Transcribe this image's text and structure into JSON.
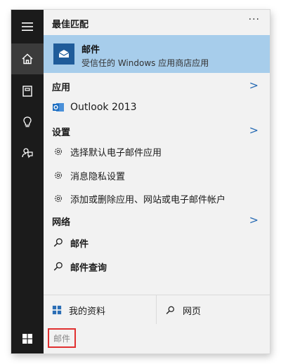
{
  "rail": {
    "items": [
      {
        "icon": "hamburger-menu-icon"
      },
      {
        "icon": "home-icon"
      },
      {
        "icon": "notebook-icon"
      },
      {
        "icon": "lightbulb-icon"
      },
      {
        "icon": "feedback-icon"
      }
    ]
  },
  "header": {
    "best_match_title": "最佳匹配",
    "more": "···"
  },
  "best_match": {
    "title": "邮件",
    "subtitle": "受信任的 Windows 应用商店应用",
    "icon": "mail-app-icon"
  },
  "sections": {
    "apps": {
      "title": "应用",
      "items": [
        {
          "label": "Outlook 2013",
          "icon": "outlook-icon"
        }
      ]
    },
    "settings": {
      "title": "设置",
      "items": [
        {
          "label": "选择默认电子邮件应用",
          "icon": "gear-icon"
        },
        {
          "label": "消息隐私设置",
          "icon": "gear-icon"
        },
        {
          "label": "添加或删除应用、网站或电子邮件帐户",
          "icon": "gear-icon"
        }
      ]
    },
    "web": {
      "title": "网络",
      "items": [
        {
          "label": "邮件",
          "icon": "search-icon"
        },
        {
          "label": "邮件查询",
          "icon": "search-icon"
        }
      ]
    }
  },
  "footer": {
    "my_stuff": "我的资料",
    "web": "网页"
  },
  "taskbar": {
    "search_value": "邮件"
  },
  "colors": {
    "rail_bg": "#1b1b1b",
    "panel_bg": "#f2f2f2",
    "highlight": "#a7cdeb",
    "accent": "#2a6db5",
    "search_border": "#e03030"
  }
}
